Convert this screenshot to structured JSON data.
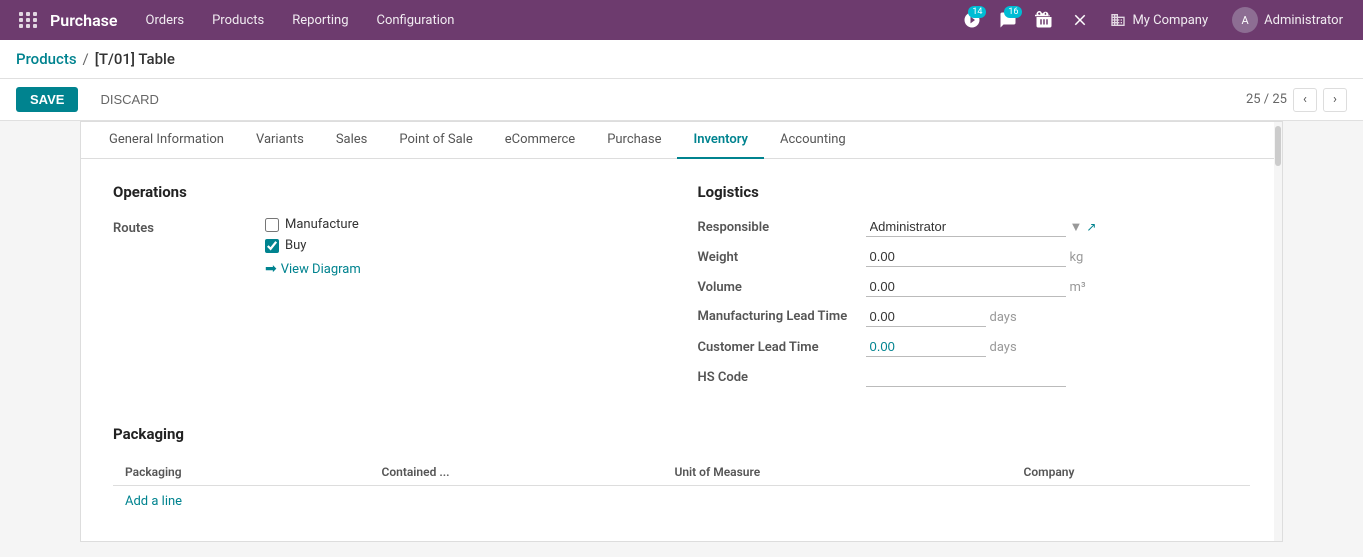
{
  "app": {
    "name": "Purchase"
  },
  "topnav": {
    "items": [
      "Orders",
      "Products",
      "Reporting",
      "Configuration"
    ]
  },
  "topbar_right": {
    "activity_count": "14",
    "message_count": "16",
    "company": "My Company",
    "user": "Administrator"
  },
  "breadcrumb": {
    "parent": "Products",
    "separator": "/",
    "current": "[T/01] Table"
  },
  "toolbar": {
    "save_label": "SAVE",
    "discard_label": "DISCARD",
    "pager": "25 / 25"
  },
  "tabs": [
    {
      "id": "general",
      "label": "General Information",
      "active": false
    },
    {
      "id": "variants",
      "label": "Variants",
      "active": false
    },
    {
      "id": "sales",
      "label": "Sales",
      "active": false
    },
    {
      "id": "pos",
      "label": "Point of Sale",
      "active": false
    },
    {
      "id": "ecommerce",
      "label": "eCommerce",
      "active": false
    },
    {
      "id": "purchase",
      "label": "Purchase",
      "active": false
    },
    {
      "id": "inventory",
      "label": "Inventory",
      "active": true
    },
    {
      "id": "accounting",
      "label": "Accounting",
      "active": false
    }
  ],
  "operations": {
    "title": "Operations",
    "routes_label": "Routes",
    "manufacture_label": "Manufacture",
    "manufacture_checked": false,
    "buy_label": "Buy",
    "buy_checked": true,
    "view_diagram_label": "View Diagram"
  },
  "logistics": {
    "title": "Logistics",
    "responsible_label": "Responsible",
    "responsible_value": "Administrator",
    "weight_label": "Weight",
    "weight_value": "0.00",
    "weight_unit": "kg",
    "volume_label": "Volume",
    "volume_value": "0.00",
    "volume_unit": "m³",
    "mfg_lead_label": "Manufacturing Lead Time",
    "mfg_lead_value": "0.00",
    "mfg_lead_unit": "days",
    "customer_lead_label": "Customer Lead Time",
    "customer_lead_value": "0.00",
    "customer_lead_unit": "days",
    "hs_code_label": "HS Code",
    "hs_code_value": ""
  },
  "packaging": {
    "title": "Packaging",
    "columns": [
      "Packaging",
      "Contained ...",
      "Unit of Measure",
      "Company"
    ],
    "add_line_label": "Add a line"
  }
}
